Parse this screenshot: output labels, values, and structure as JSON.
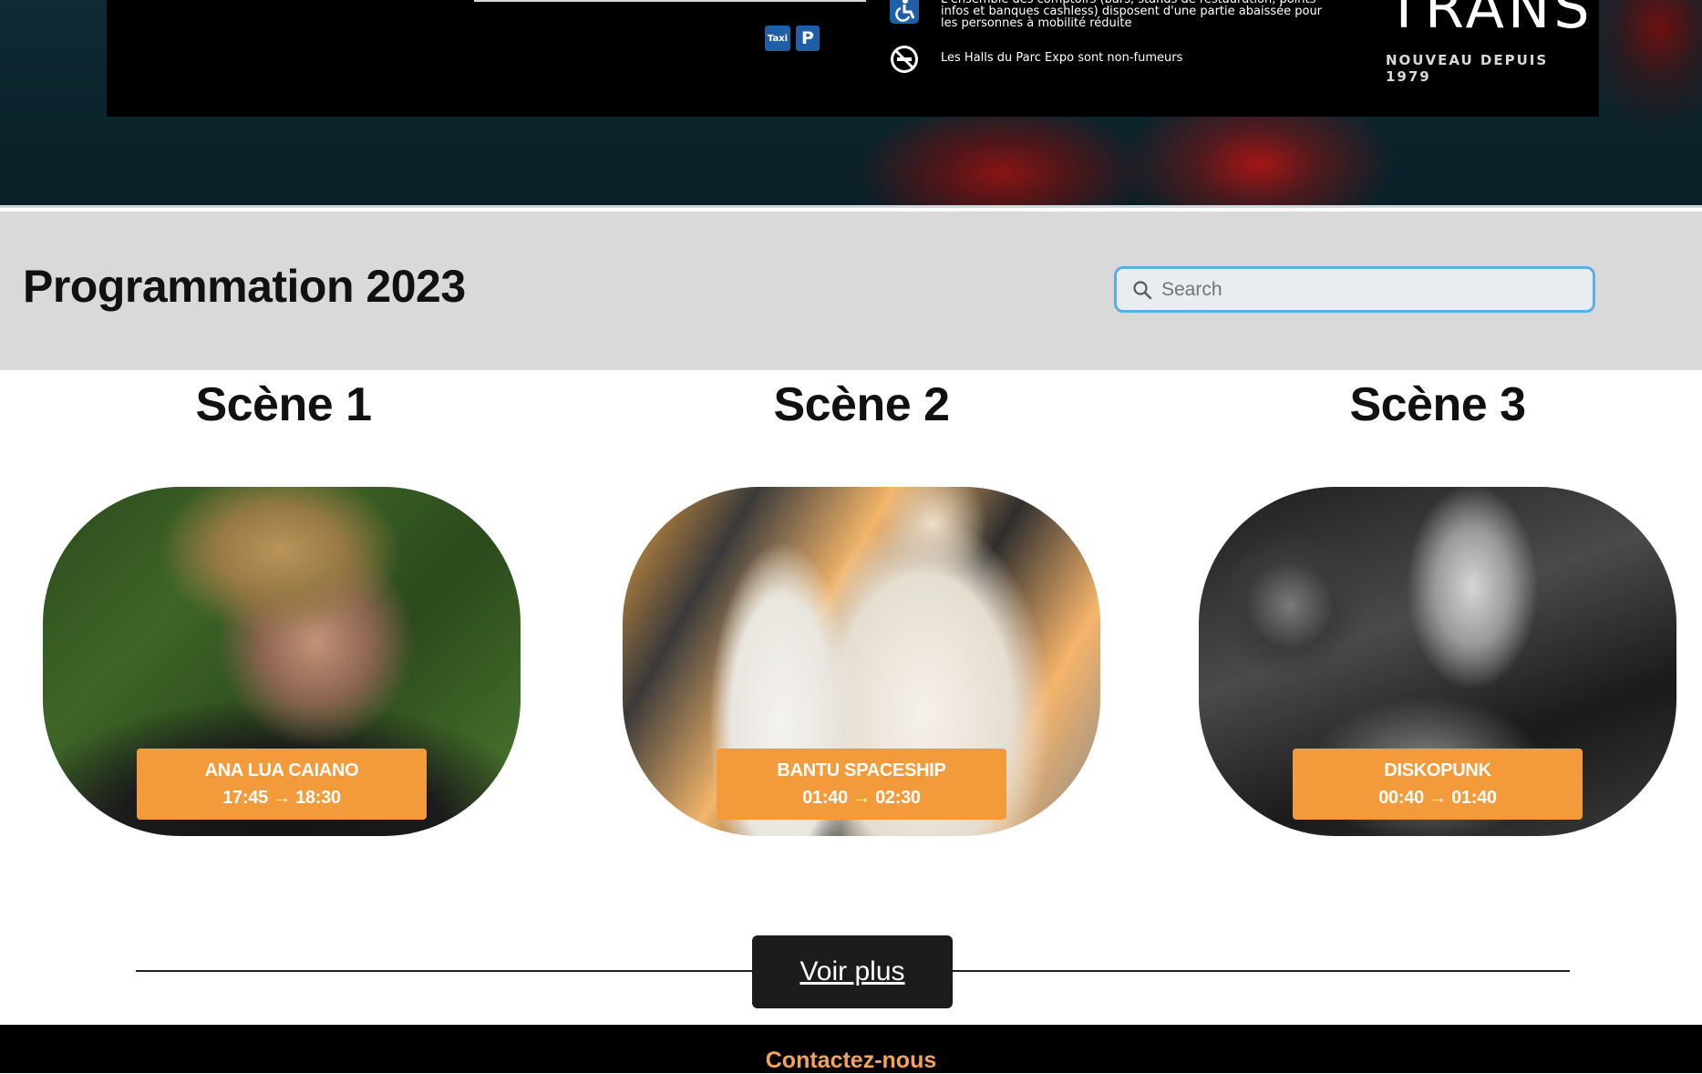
{
  "hero": {
    "taxi_badge": "Taxi",
    "parking_badge": "P",
    "accessibility_note": "L'ensemble des comptoirs (bars, stands de restauration, points infos et banques cashless) disposent d'une partie abaissée pour les personnes à mobilité réduite",
    "smoking_note": "Les Halls du Parc Expo sont non-fumeurs",
    "brand_mark": "TRANS",
    "brand_tagline": "NOUVEAU DEPUIS 1979"
  },
  "programme": {
    "title": "Programmation 2023",
    "search_placeholder": "Search"
  },
  "stages": [
    {
      "title": "Scène 1",
      "artist": "ANA LUA CAIANO",
      "time": "17:45 → 18:30"
    },
    {
      "title": "Scène 2",
      "artist": "BANTU SPACESHIP",
      "time": "01:40 → 02:30"
    },
    {
      "title": "Scène 3",
      "artist": "DISKOPUNK",
      "time": "00:40 → 01:40"
    }
  ],
  "more_button": "Voir plus",
  "footer": {
    "contact_link": "Contactez-nous"
  },
  "colors": {
    "accent_orange": "#f39a3a",
    "search_border": "#5aaee0",
    "footer_link": "#f3a45a"
  }
}
